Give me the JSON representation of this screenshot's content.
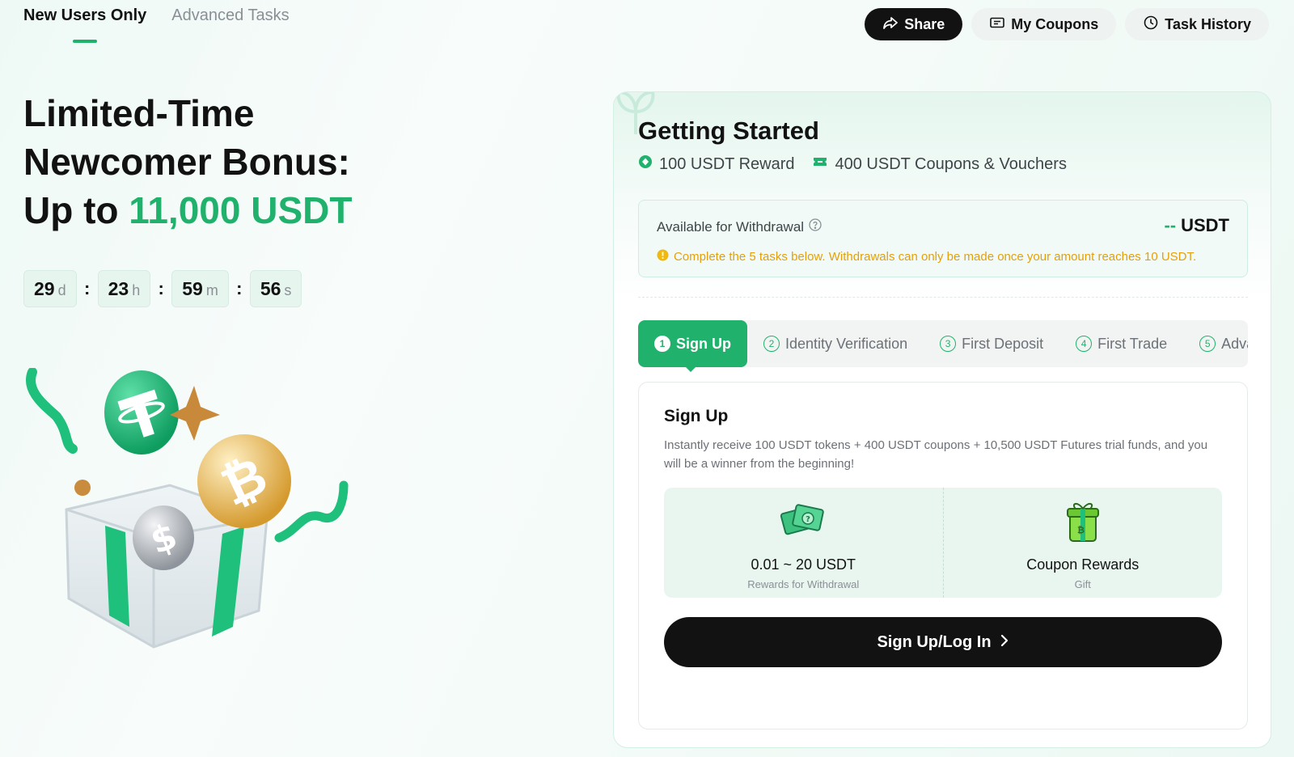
{
  "top_tabs": {
    "new_users": "New Users Only",
    "advanced": "Advanced Tasks"
  },
  "actions": {
    "share": "Share",
    "coupons": "My Coupons",
    "history": "Task History"
  },
  "hero": {
    "line1": "Limited-Time",
    "line2": "Newcomer Bonus:",
    "line3_prefix": "Up to ",
    "line3_amount": "11,000 USDT"
  },
  "countdown": {
    "days": "29",
    "days_unit": "d",
    "hours": "23",
    "hours_unit": "h",
    "minutes": "59",
    "minutes_unit": "m",
    "seconds": "56",
    "seconds_unit": "s",
    "separator": ":"
  },
  "card": {
    "title": "Getting Started",
    "reward_label": "100 USDT Reward",
    "coupon_label": "400 USDT Coupons & Vouchers",
    "withdraw_label": "Available for Withdrawal",
    "withdraw_amount": "--",
    "withdraw_currency": "USDT",
    "withdraw_note": "Complete the 5 tasks below. Withdrawals can only be made once your amount reaches 10 USDT."
  },
  "steps": [
    {
      "num": "1",
      "label": "Sign Up"
    },
    {
      "num": "2",
      "label": "Identity Verification"
    },
    {
      "num": "3",
      "label": "First Deposit"
    },
    {
      "num": "4",
      "label": "First Trade"
    },
    {
      "num": "5",
      "label": "Adva"
    }
  ],
  "task": {
    "title": "Sign Up",
    "description": "Instantly receive 100 USDT tokens + 400 USDT coupons + 10,500 USDT Futures trial funds, and you will be a winner from the beginning!",
    "rewards": [
      {
        "value": "0.01 ~ 20 USDT",
        "sub": "Rewards for Withdrawal",
        "icon": "cash-icon"
      },
      {
        "value": "Coupon Rewards",
        "sub": "Gift",
        "icon": "gift-icon"
      }
    ],
    "cta": "Sign Up/Log In"
  },
  "colors": {
    "accent": "#20b26c",
    "dark": "#121212",
    "warning": "#e4a00b"
  }
}
